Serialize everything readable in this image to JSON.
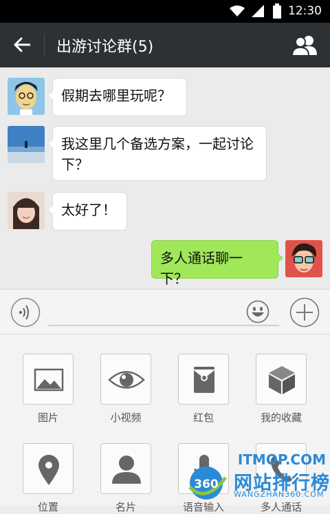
{
  "status_bar": {
    "time": "12:30"
  },
  "header": {
    "title": "出游讨论群(5)"
  },
  "messages": [
    {
      "side": "left",
      "text": "假期去哪里玩呢？"
    },
    {
      "side": "left",
      "text": "我这里几个备选方案，一起讨论下？"
    },
    {
      "side": "left",
      "text": "太好了！"
    },
    {
      "side": "right",
      "text": "多人通话聊一下？"
    }
  ],
  "input": {
    "value": ""
  },
  "panel": {
    "items": [
      {
        "label": "图片",
        "icon": "image-icon"
      },
      {
        "label": "小视频",
        "icon": "eye-icon"
      },
      {
        "label": "红包",
        "icon": "red-packet-icon"
      },
      {
        "label": "我的收藏",
        "icon": "cube-icon"
      },
      {
        "label": "位置",
        "icon": "location-icon"
      },
      {
        "label": "名片",
        "icon": "contact-card-icon"
      },
      {
        "label": "语音输入",
        "icon": "microphone-icon"
      },
      {
        "label": "多人通话",
        "icon": "phone-icon"
      }
    ]
  },
  "watermark": {
    "brand": "网站排行榜",
    "domain": "WANGZHAN360.COM",
    "badge": "360",
    "top": "ITMOP.COM"
  },
  "colors": {
    "header": "#2e3133",
    "sent_bubble": "#a0e759",
    "accent": "#2b8ad6"
  }
}
